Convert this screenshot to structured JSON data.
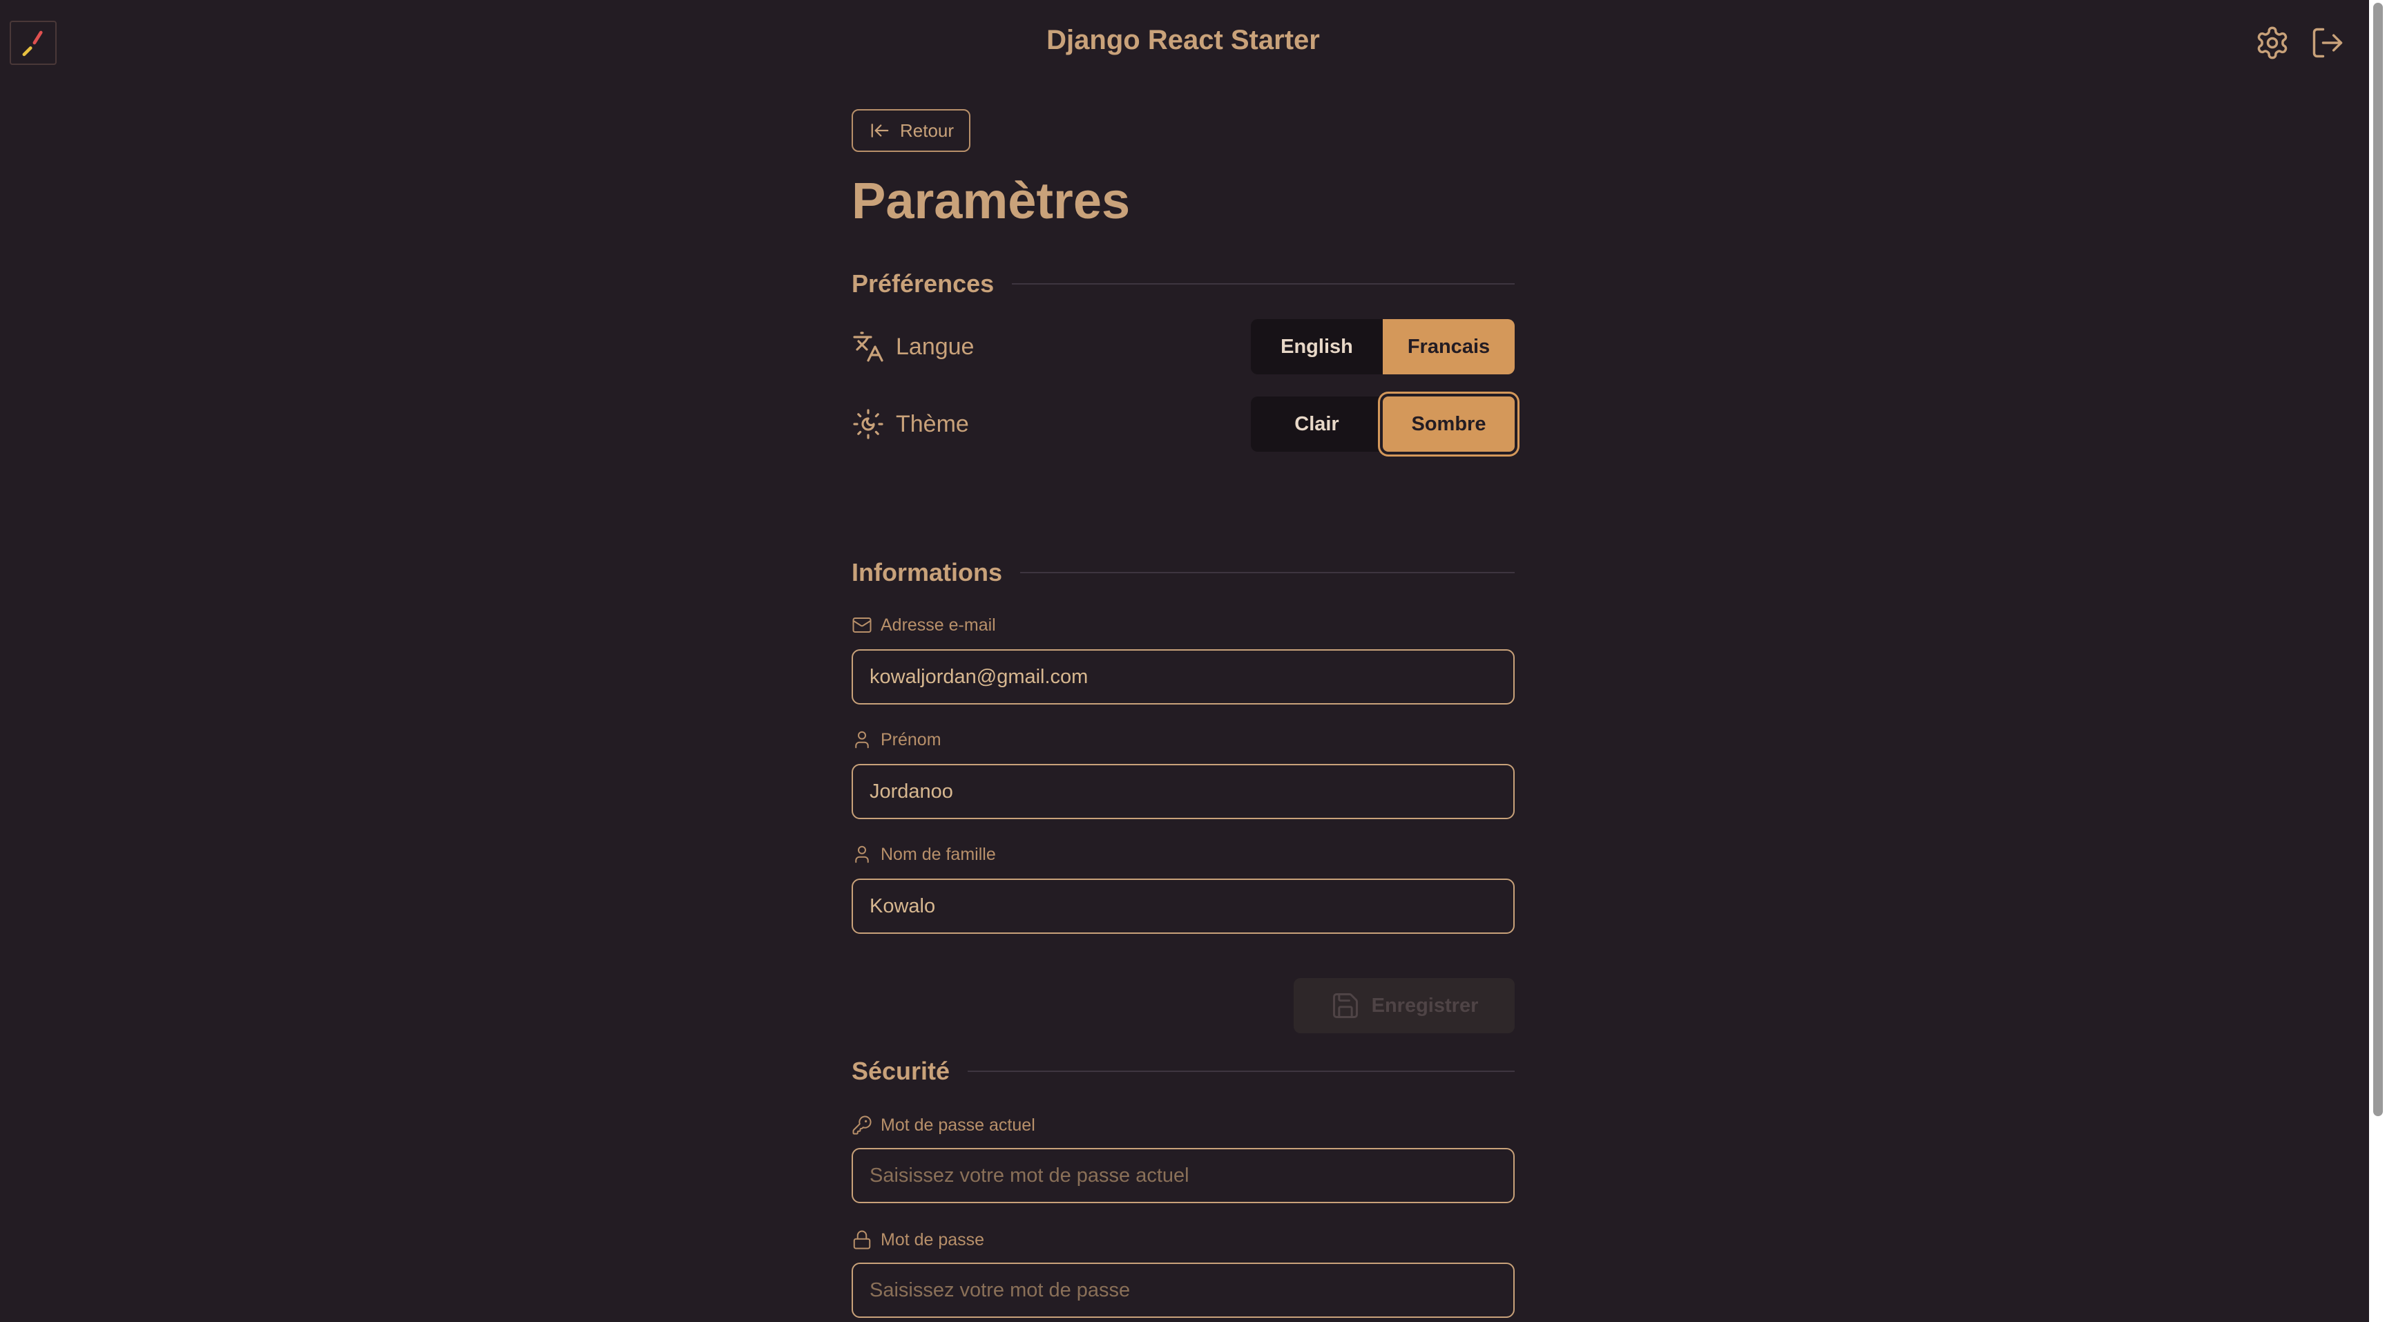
{
  "header": {
    "title": "Django React Starter",
    "logo_icon": "app-logo",
    "settings_icon": "gear-icon",
    "logout_icon": "logout-icon"
  },
  "page": {
    "back_label": "Retour",
    "title": "Paramètres"
  },
  "preferences": {
    "section_title": "Préférences",
    "language": {
      "label": "Langue",
      "options": [
        "English",
        "Francais"
      ],
      "selected": "Francais"
    },
    "theme": {
      "label": "Thème",
      "options": [
        "Clair",
        "Sombre"
      ],
      "selected": "Sombre"
    }
  },
  "informations": {
    "section_title": "Informations",
    "email": {
      "label": "Adresse e-mail",
      "value": "kowaljordan@gmail.com"
    },
    "first_name": {
      "label": "Prénom",
      "value": "Jordanoo"
    },
    "last_name": {
      "label": "Nom de famille",
      "value": "Kowalo"
    },
    "save_label": "Enregistrer"
  },
  "security": {
    "section_title": "Sécurité",
    "current_password": {
      "label": "Mot de passe actuel",
      "placeholder": "Saisissez votre mot de passe actuel"
    },
    "password": {
      "label": "Mot de passe",
      "placeholder": "Saisissez votre mot de passe"
    }
  },
  "colors": {
    "background": "#231c23",
    "accent": "#d4985a",
    "text": "#c9a27a"
  }
}
